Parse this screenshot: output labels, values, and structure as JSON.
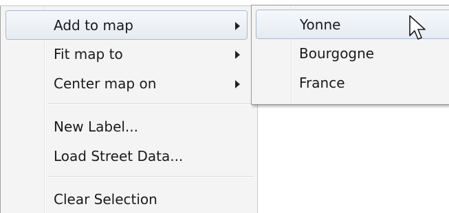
{
  "context_menu": {
    "items": [
      {
        "label": "Add to map",
        "has_submenu": true,
        "highlighted": true
      },
      {
        "label": "Fit map to",
        "has_submenu": true,
        "highlighted": false
      },
      {
        "label": "Center map on",
        "has_submenu": true,
        "highlighted": false
      },
      {
        "label": "New Label...",
        "has_submenu": false,
        "highlighted": false
      },
      {
        "label": "Load Street Data...",
        "has_submenu": false,
        "highlighted": false
      },
      {
        "label": "Clear Selection",
        "has_submenu": false,
        "highlighted": false
      }
    ]
  },
  "submenu": {
    "items": [
      {
        "label": "Yonne",
        "highlighted": true
      },
      {
        "label": "Bourgogne",
        "highlighted": false
      },
      {
        "label": "France",
        "highlighted": false
      }
    ]
  },
  "icons": {
    "submenu_arrow": "chevron-right-icon",
    "cursor": "mouse-pointer-icon"
  },
  "colors": {
    "menu_background": "#f4f4f4",
    "highlight_border": "#a9b9cf",
    "highlight_fill": "#e5ebf2",
    "text": "#1a1a1a"
  }
}
